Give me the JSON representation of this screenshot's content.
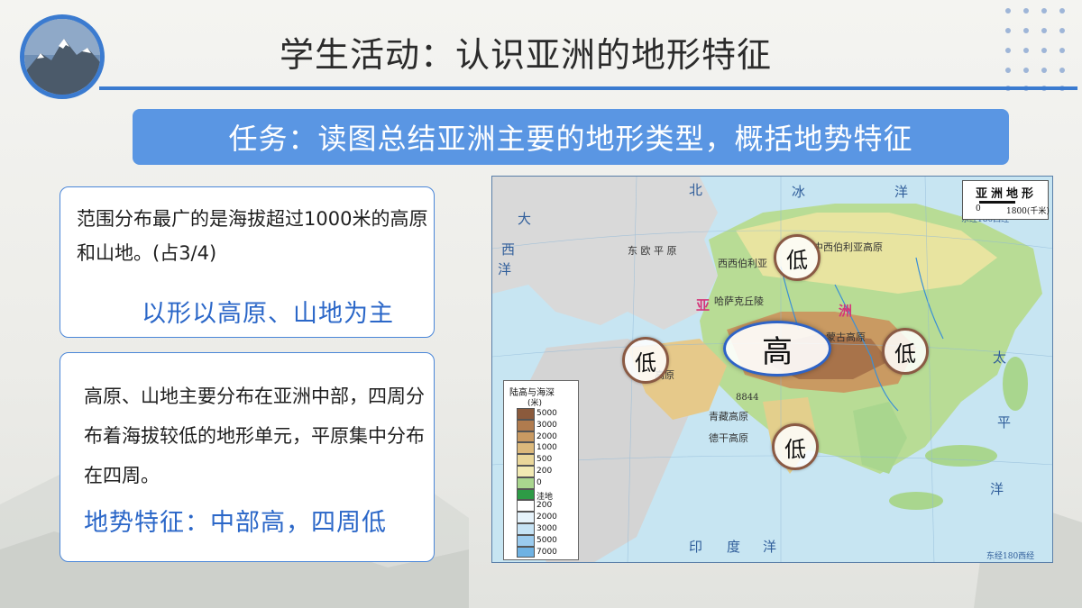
{
  "header": {
    "title": "学生活动：认识亚洲的地形特征"
  },
  "task": {
    "text": "任务：读图总结亚洲主要的地形类型，概括地势特征"
  },
  "cards": [
    {
      "body": "范围分布最广的是海拔超过1000米的高原和山地。(占3/4)",
      "highlight": "以形以高原、山地为主"
    },
    {
      "body": "高原、山地主要分布在亚洲中部，四周分布着海拔较低的地形单元，平原集中分布在四周。",
      "highlight": "地势特征：中部高，四周低"
    }
  ],
  "map": {
    "title": "亚洲地形",
    "scale_labels": [
      "0",
      "1800(千米)"
    ],
    "meridian_label_top": "东经180西经",
    "meridian_label_bottom": "东经180西经",
    "ocean_labels": {
      "north_1": "北",
      "north_2": "冰",
      "north_3": "洋",
      "atlantic_1": "大",
      "atlantic_2": "西",
      "atlantic_3": "洋",
      "pacific_1": "太",
      "pacific_2": "平",
      "pacific_3": "洋",
      "indian_1": "印",
      "indian_2": "度",
      "indian_3": "洋"
    },
    "region_labels": {
      "asia_1": "亚",
      "asia_2": "洲",
      "east_europe": "东 欧 平 原",
      "west_siberia": "西西伯利亚",
      "central_siberia": "中西伯利亚高原",
      "kazakh": "哈萨克丘陵",
      "tibet": "青藏高原",
      "everest": "8844",
      "mongolia": "蒙古高原",
      "deccan": "德干高原",
      "arabia": "高原"
    },
    "legend": {
      "title": "陆高与海深",
      "unit": "(米)",
      "levels": [
        "5000",
        "3000",
        "2000",
        "1000",
        "500",
        "200",
        "0",
        "洼地",
        "200",
        "2000",
        "3000",
        "5000",
        "7000"
      ],
      "colors": [
        "#8b5a3c",
        "#b07b4e",
        "#c99a62",
        "#dcb97c",
        "#ead79a",
        "#f2eab3",
        "#a9d68e",
        "#2e9b46",
        "#ffffff",
        "#e6f3fb",
        "#c6e3f5",
        "#9bcbee",
        "#6fb2e3"
      ]
    },
    "bubbles": {
      "high": "高",
      "low_north": "低",
      "low_west": "低",
      "low_east": "低",
      "low_south": "低"
    }
  }
}
